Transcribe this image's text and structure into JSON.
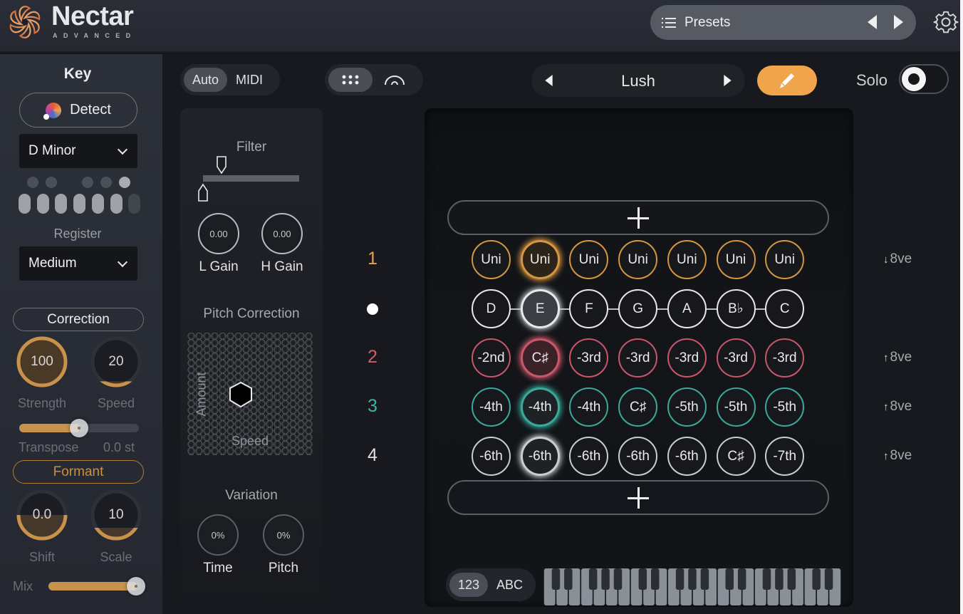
{
  "app": {
    "name": "Nectar",
    "edition": "ADVANCED"
  },
  "presets": {
    "label": "Presets",
    "icon": "list-icon",
    "prev_icon": "triangle-left-icon",
    "next_icon": "triangle-right-icon"
  },
  "settings_icon": "gear-icon",
  "key_panel": {
    "title": "Key",
    "detect_label": "Detect",
    "key_value": "D Minor",
    "scale_dots_top": [
      {
        "on": false,
        "active": false
      },
      {
        "on": false,
        "active": false
      },
      null,
      {
        "on": false,
        "active": false
      },
      {
        "on": false,
        "active": false
      },
      {
        "on": true,
        "active": true
      }
    ],
    "scale_dots_bottom": [
      true,
      true,
      true,
      true,
      true,
      true,
      false
    ],
    "register_label": "Register",
    "register_value": "Medium"
  },
  "correction": {
    "title": "Correction",
    "strength": {
      "label": "Strength",
      "value": "100",
      "fraction": 1.0
    },
    "speed": {
      "label": "Speed",
      "value": "20",
      "fraction": 0.2
    },
    "transpose": {
      "label": "Transpose",
      "value": "0.0 st",
      "fraction": 0.5
    }
  },
  "formant": {
    "title": "Formant",
    "shift": {
      "label": "Shift",
      "value": "0.0",
      "fraction": 0.5
    },
    "scale": {
      "label": "Scale",
      "value": "10",
      "fraction": 0.25
    }
  },
  "mix": {
    "label": "Mix",
    "fraction": 1.0
  },
  "mode_toggle": {
    "options": [
      "Auto",
      "MIDI"
    ],
    "selected": "Auto"
  },
  "view_toggle": {
    "options": [
      "grid-view-icon",
      "arc-view-icon"
    ],
    "selected": "grid-view-icon"
  },
  "filter": {
    "title": "Filter",
    "l_gain": {
      "label": "L Gain",
      "value": "0.00"
    },
    "h_gain": {
      "label": "H Gain",
      "value": "0.00"
    }
  },
  "pitch_correction": {
    "title": "Pitch Correction",
    "y_label": "Amount",
    "x_label": "Speed"
  },
  "variation": {
    "title": "Variation",
    "time": {
      "label": "Time",
      "value": "0%"
    },
    "pitch": {
      "label": "Pitch",
      "value": "0%"
    }
  },
  "style_selector": {
    "value": "Lush",
    "prev_icon": "triangle-left-icon",
    "next_icon": "triangle-right-icon"
  },
  "edit_button_icon": "pencil-icon",
  "solo": {
    "label": "Solo",
    "on": false
  },
  "colors": {
    "orange": "#d89540",
    "white": "#c9ccd0",
    "red": "#c9566a",
    "teal": "#3aa99a",
    "accent": "#f0a44c"
  },
  "harmony": {
    "lanes": [
      {
        "number": "1",
        "color": "orange",
        "octave": "8ve",
        "octave_dir": "down",
        "cells": [
          "Uni",
          "Uni",
          "Uni",
          "Uni",
          "Uni",
          "Uni",
          "Uni"
        ]
      },
      {
        "number": "",
        "color": "white",
        "octave": "",
        "octave_dir": "",
        "is_lead": true,
        "cells": [
          "D",
          "E",
          "F",
          "G",
          "A",
          "B♭",
          "C"
        ]
      },
      {
        "number": "2",
        "color": "red",
        "octave": "8ve",
        "octave_dir": "up",
        "cells": [
          "-2nd",
          "C♯",
          "-3rd",
          "-3rd",
          "-3rd",
          "-3rd",
          "-3rd"
        ]
      },
      {
        "number": "3",
        "color": "teal",
        "octave": "8ve",
        "octave_dir": "up",
        "cells": [
          "-4th",
          "-4th",
          "-4th",
          "C♯",
          "-5th",
          "-5th",
          "-5th"
        ]
      },
      {
        "number": "4",
        "color": "white",
        "octave": "8ve",
        "octave_dir": "up",
        "cells": [
          "-6th",
          "-6th",
          "-6th",
          "-6th",
          "-6th",
          "C♯",
          "-7th"
        ]
      }
    ],
    "selected_column": 1,
    "add_icon": "plus-icon"
  },
  "label_toggle": {
    "options": [
      "123",
      "ABC"
    ],
    "selected": "123"
  }
}
